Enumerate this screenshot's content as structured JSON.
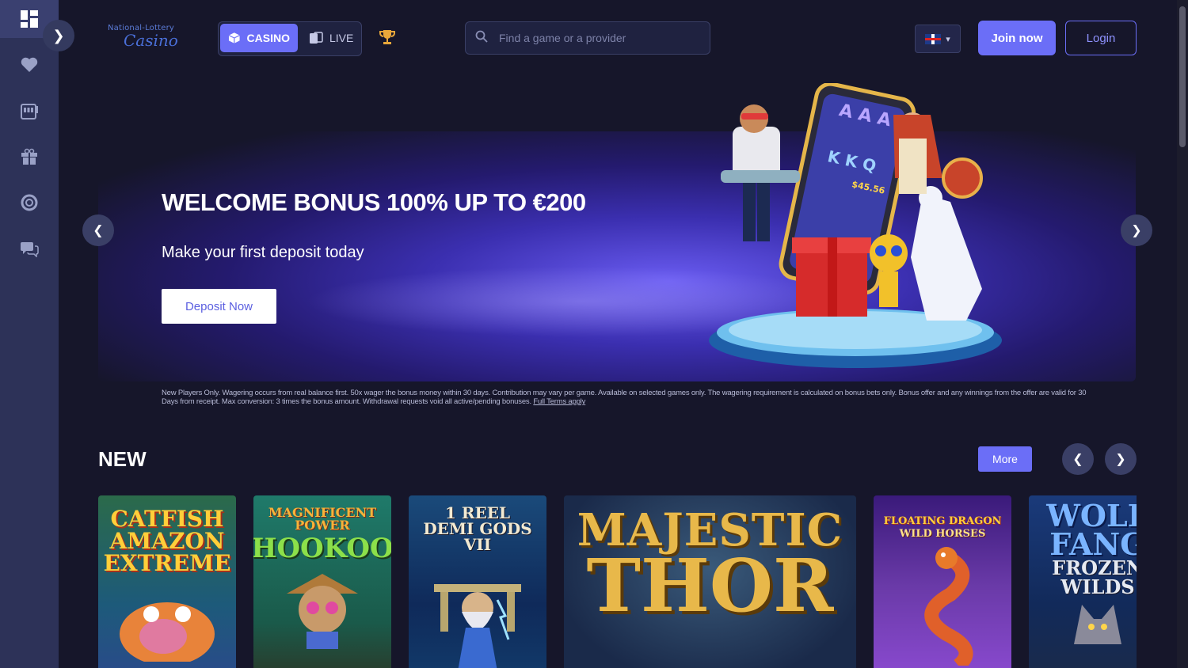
{
  "sidebar": {
    "items": [
      {
        "icon": "dashboard-icon",
        "active": true
      },
      {
        "icon": "heart-icon"
      },
      {
        "icon": "slot-machine-icon"
      },
      {
        "icon": "gift-icon"
      },
      {
        "icon": "lifebuoy-icon"
      },
      {
        "icon": "chat-support-icon"
      }
    ],
    "toggle_icon": "chevron-right-icon"
  },
  "header": {
    "logo_top": "National-Lottery",
    "logo_bottom": "Casino",
    "modes": {
      "casino": "CASINO",
      "live": "LIVE"
    },
    "search_placeholder": "Find a game or a provider",
    "language": "en-GB",
    "join_label": "Join now",
    "login_label": "Login"
  },
  "hero": {
    "title": "WELCOME BONUS 100% UP TO €200",
    "subtitle": "Make your first deposit today",
    "cta": "Deposit Now",
    "slot_win": "$45.56"
  },
  "terms": {
    "text": "New Players Only. Wagering occurs from real balance first. 50x wager the bonus money within 30 days. Contribution may vary per game. Available on selected games only. The wagering requirement is calculated on bonus bets only. Bonus offer and any winnings from the offer are valid for 30 Days from receipt. Max conversion: 3 times the bonus amount. Withdrawal requests void all active/pending bonuses.",
    "link": "Full Terms apply"
  },
  "new_section": {
    "title": "NEW",
    "more_label": "More",
    "games": [
      {
        "name": "Catfish Amazon Extreme",
        "lines": [
          "CATFISH",
          "AMAZON",
          "EXTREME"
        ]
      },
      {
        "name": "Magnificent Power Hookoo",
        "lines": [
          "MAGNIFICENT",
          "POWER",
          "HOOKOO"
        ]
      },
      {
        "name": "1 Reel Demi Gods VII",
        "lines": [
          "1 REEL",
          "DEMI GODS VII"
        ]
      },
      {
        "name": "Majestic Thor",
        "lines": [
          "MAJESTIC",
          "THOR"
        ]
      },
      {
        "name": "Floating Dragon Wild Horses",
        "lines": [
          "FLOATING DRAGON",
          "WILD HORSES"
        ]
      },
      {
        "name": "Wolf Fang Frozen Wilds",
        "lines": [
          "WOLF",
          "FANG",
          "FROZEN",
          "WILDS"
        ]
      }
    ]
  }
}
